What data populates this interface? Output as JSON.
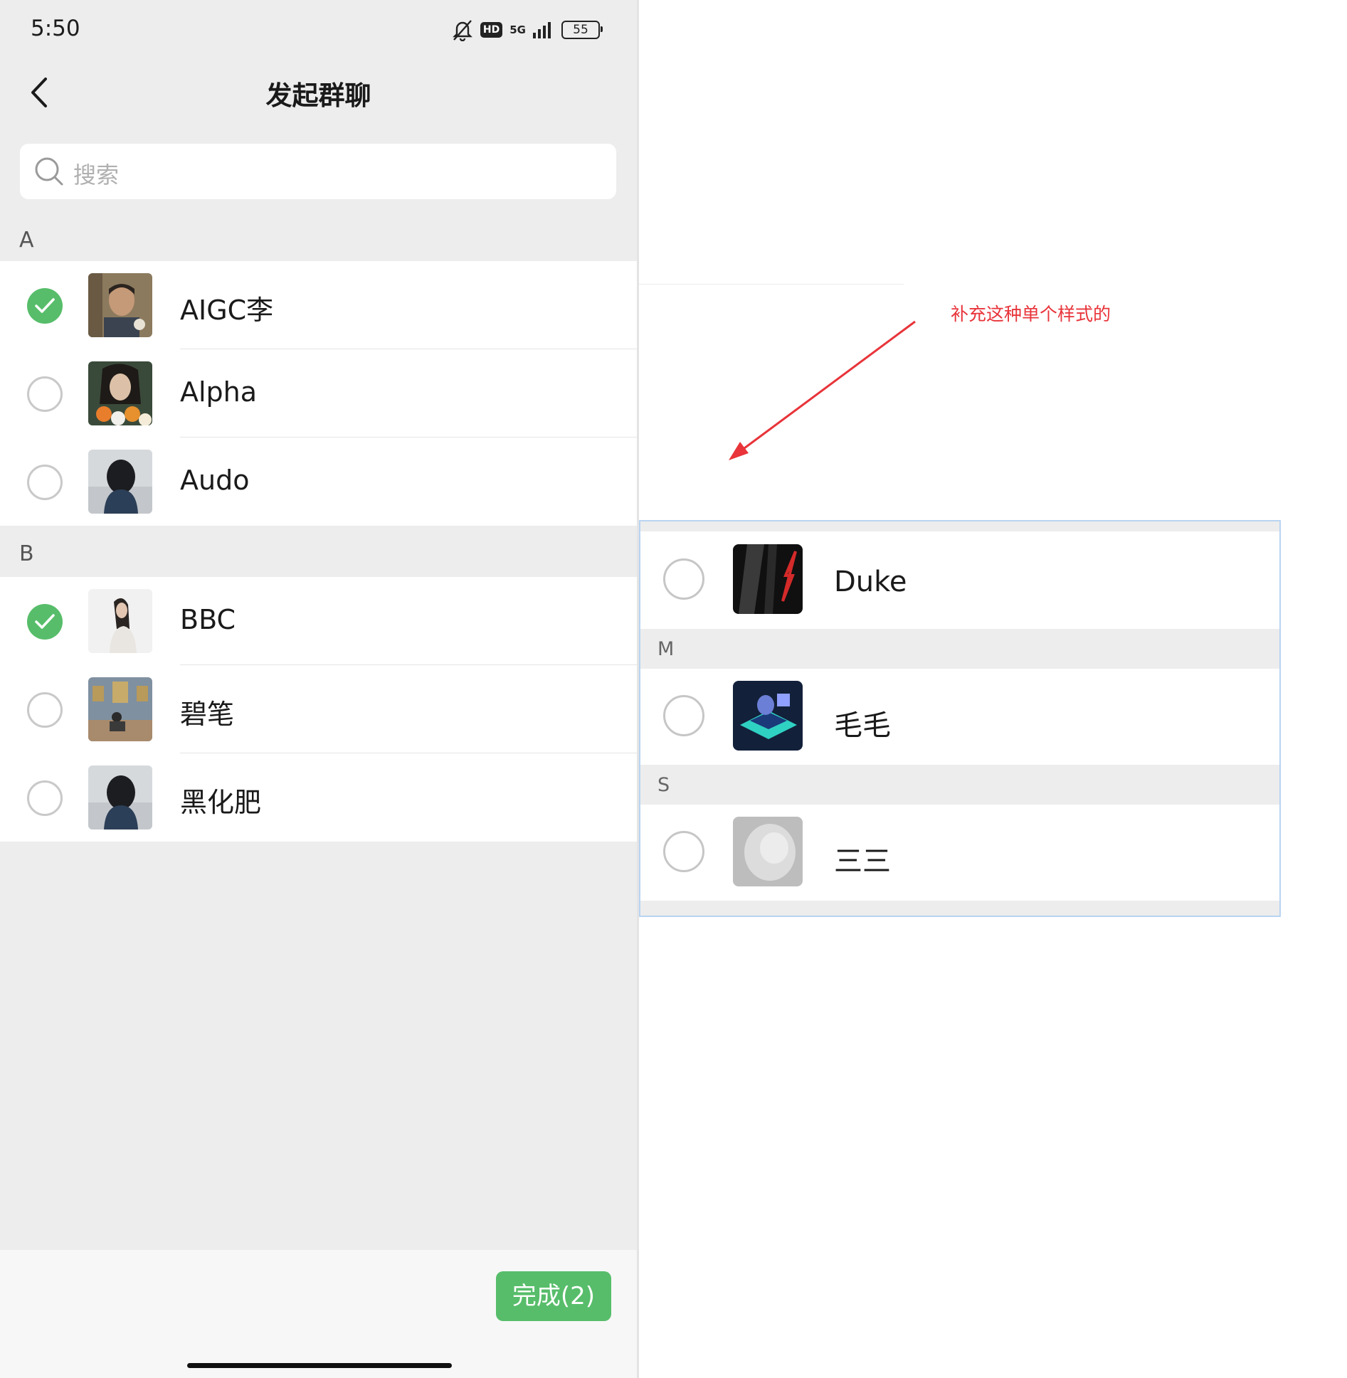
{
  "status_bar": {
    "time": "5:50",
    "hd": "HD",
    "network": "5G",
    "battery": "55"
  },
  "header": {
    "title": "发起群聊"
  },
  "search": {
    "placeholder": "搜索"
  },
  "sections": [
    {
      "letter": "A",
      "contacts": [
        {
          "name": "AIGC李",
          "checked": true
        },
        {
          "name": "Alpha",
          "checked": false
        },
        {
          "name": "Audo",
          "checked": false
        }
      ]
    },
    {
      "letter": "B",
      "contacts": [
        {
          "name": "BBC",
          "checked": true
        },
        {
          "name": "碧笔",
          "checked": false
        },
        {
          "name": "黑化肥",
          "checked": false
        }
      ]
    }
  ],
  "footer": {
    "done_label": "完成(2)"
  },
  "annotation": {
    "note": "补充这种单个样式的",
    "arrow_color": "#e8343a",
    "example": {
      "contacts": [
        {
          "name": "Duke"
        },
        {
          "name": "毛毛"
        },
        {
          "name": "三三"
        }
      ],
      "headers": [
        "M",
        "S"
      ]
    }
  },
  "colors": {
    "accent": "#57bd6a",
    "background": "#ededed"
  }
}
